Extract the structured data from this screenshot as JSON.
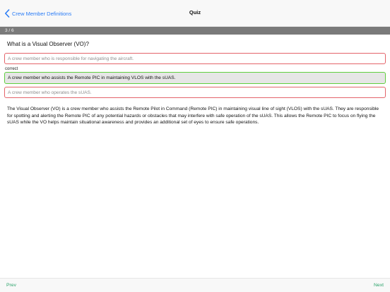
{
  "navbar": {
    "back_label": "Crew Member Definitions",
    "title": "Quiz"
  },
  "progress": {
    "text": "3 / 6"
  },
  "quiz": {
    "question": "What is a Visual Observer (VO)?",
    "correct_label": "correct",
    "answers": [
      {
        "text": "A crew member who is responsible for navigating the aircraft.",
        "status": "incorrect"
      },
      {
        "text": "A crew member who assists the Remote PIC in maintaining VLOS with the sUAS.",
        "status": "correct"
      },
      {
        "text": "A crew member who operates the sUAS.",
        "status": "incorrect"
      }
    ],
    "explanation": "The Visual Observer (VO) is a crew member who assists the Remote Pilot in Command (Remote PIC) in maintaining visual line of sight (VLOS) with the sUAS. They are responsible for spotting and alerting the Remote PIC of any potential hazards or obstacles that may interfere with safe operation of the sUAS. This allows the Remote PIC to focus on flying the sUAS while the VO helps maintain situational awareness and provides an additional set of eyes to ensure safe operations."
  },
  "footer": {
    "prev_label": "Prev",
    "next_label": "Next"
  },
  "colors": {
    "link_blue": "#2a7cf6",
    "link_green": "#2ba36b",
    "correct_border": "#5fcf3e",
    "incorrect_border": "#e3646a",
    "progress_bar": "#7a7a7a"
  },
  "icons": {
    "back": "chevron-left-icon"
  }
}
